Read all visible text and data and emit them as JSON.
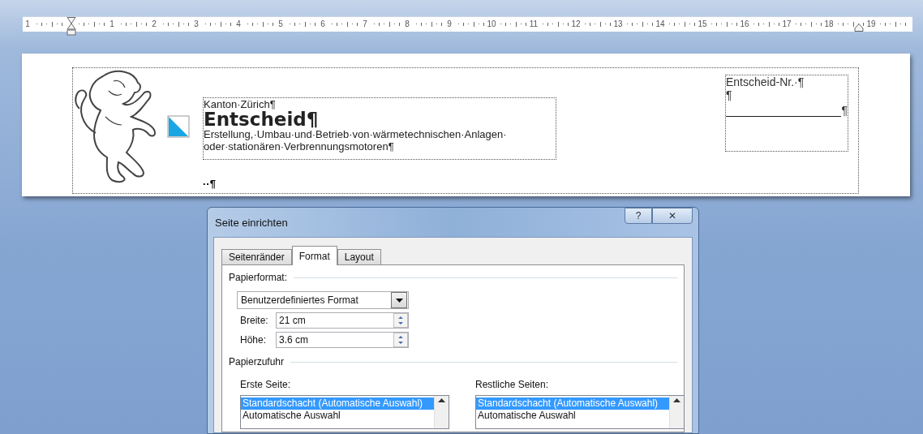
{
  "ruler": {
    "labels": [
      "1",
      "1",
      "2",
      "3",
      "4",
      "5",
      "6",
      "7",
      "8",
      "9",
      "10",
      "11",
      "12",
      "13",
      "14",
      "15",
      "16",
      "17",
      "18",
      "19"
    ]
  },
  "document": {
    "header": {
      "title_block": {
        "canton": "Kanton·Zürich¶",
        "title": "Entscheid¶",
        "subtitle": "Erstellung,·Umbau·und·Betrieb·von·wärmetechnischen·Anlagen· oder·stationären·Verbrennungsmotoren¶"
      },
      "after_mark": "··¶",
      "number_box": {
        "label": "Entscheid-Nr.·¶",
        "empty_mark": "¶",
        "line_mark": "¶"
      }
    }
  },
  "dialog": {
    "title": "Seite einrichten",
    "help": "?",
    "close": "✕",
    "tabs": [
      {
        "label": "Seitenränder",
        "selected": false
      },
      {
        "label": "Format",
        "selected": true
      },
      {
        "label": "Layout",
        "selected": false
      }
    ],
    "paper_format": {
      "heading": "Papierformat:",
      "value": "Benutzerdefiniertes Format",
      "fields": [
        {
          "label": "Breite:",
          "value": "21 cm"
        },
        {
          "label": "Höhe:",
          "value": "3.6 cm"
        }
      ]
    },
    "paper_source": {
      "heading": "Papierzufuhr",
      "lists": [
        {
          "label": "Erste Seite:",
          "items": [
            {
              "text": "Standardschacht (Automatische Auswahl)",
              "selected": true
            },
            {
              "text": "Automatische Auswahl",
              "selected": false
            }
          ]
        },
        {
          "label": "Restliche Seiten:",
          "items": [
            {
              "text": "Standardschacht (Automatische Auswahl)",
              "selected": true
            },
            {
              "text": "Automatische Auswahl",
              "selected": false
            }
          ]
        }
      ]
    }
  }
}
